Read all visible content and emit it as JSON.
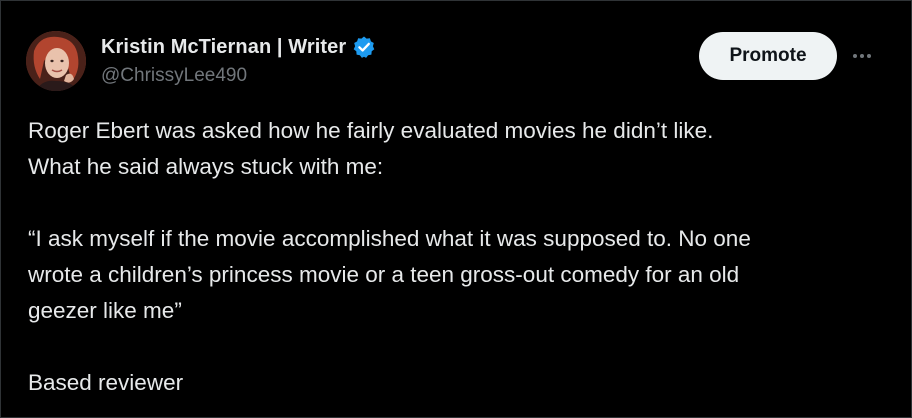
{
  "author": {
    "display_name": "Kristin McTiernan | Writer",
    "handle": "@ChrissyLee490",
    "verified": true
  },
  "actions": {
    "promote_label": "Promote",
    "more_icon": "more-horizontal-icon"
  },
  "tweet": {
    "paragraph1_line1": "Roger Ebert was asked how he fairly evaluated movies he didn’t like.",
    "paragraph1_line2": "What he said always stuck with me:",
    "paragraph2_line1": "“I ask myself if the movie accomplished what it was supposed to. No one",
    "paragraph2_line2": "wrote a children’s princess movie or a teen gross-out comedy for an old",
    "paragraph2_line3": "geezer like me”",
    "paragraph3_line1": "Based reviewer"
  },
  "colors": {
    "background": "#000000",
    "text_primary": "#e7e9ea",
    "text_secondary": "#71767b",
    "verified_blue": "#1d9bf0",
    "button_bg": "#eff3f4",
    "button_text": "#0f1419"
  }
}
